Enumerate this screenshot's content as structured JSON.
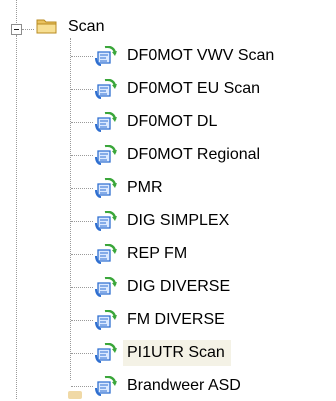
{
  "tree": {
    "root": {
      "label": "Scan",
      "expanded": true,
      "icon": "folder-open-icon"
    },
    "items": [
      {
        "label": "DF0MOT VWV Scan",
        "icon": "scan-channel-icon",
        "selected": false
      },
      {
        "label": "DF0MOT EU Scan",
        "icon": "scan-channel-icon",
        "selected": false
      },
      {
        "label": "DF0MOT DL",
        "icon": "scan-channel-icon",
        "selected": false
      },
      {
        "label": "DF0MOT Regional",
        "icon": "scan-channel-icon",
        "selected": false
      },
      {
        "label": "PMR",
        "icon": "scan-channel-icon",
        "selected": false
      },
      {
        "label": "DIG SIMPLEX",
        "icon": "scan-channel-icon",
        "selected": false
      },
      {
        "label": "REP  FM",
        "icon": "scan-channel-icon",
        "selected": false
      },
      {
        "label": "DIG DIVERSE",
        "icon": "scan-channel-icon",
        "selected": false
      },
      {
        "label": "FM DIVERSE",
        "icon": "scan-channel-icon",
        "selected": false
      },
      {
        "label": "PI1UTR Scan",
        "icon": "scan-channel-icon",
        "selected": true
      },
      {
        "label": "Brandweer ASD",
        "icon": "scan-channel-icon",
        "selected": false
      }
    ]
  },
  "colors": {
    "folder": "#f2d27a",
    "icon_green": "#3aa63a",
    "icon_blue": "#2f6fd0",
    "selection_bg": "#f4f2e6"
  }
}
